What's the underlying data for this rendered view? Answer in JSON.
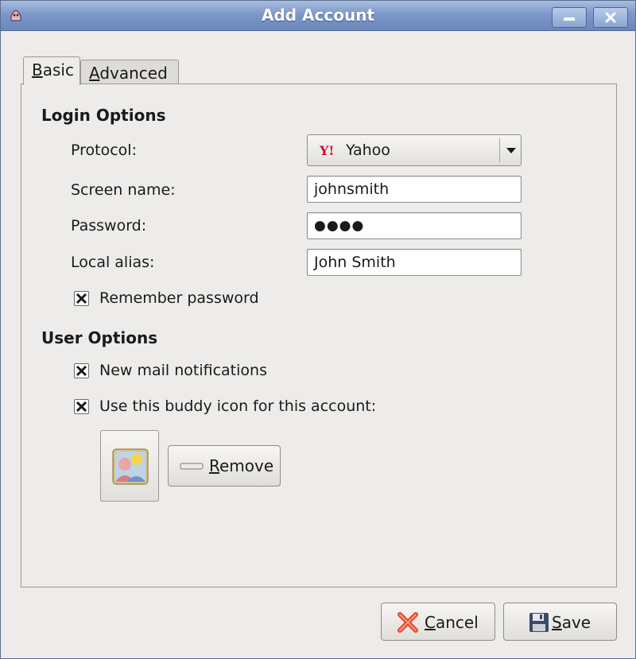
{
  "window": {
    "title": "Add Account",
    "minimize_icon": "minimize-icon",
    "close_label": "x"
  },
  "tabs": [
    {
      "label": "Basic",
      "selected": true
    },
    {
      "label": "Advanced",
      "selected": false
    }
  ],
  "login_options": {
    "title": "Login Options",
    "protocol_label": "Protocol:",
    "protocol_value": "Yahoo",
    "protocol_icon": "yahoo-icon",
    "screen_name_label": "Screen name:",
    "screen_name_value": "johnsmith",
    "password_label": "Password:",
    "password_value": "●●●●",
    "local_alias_label": "Local alias:",
    "local_alias_value": "John Smith",
    "remember_password_label": "Remember password",
    "remember_password_checked": true
  },
  "user_options": {
    "title": "User Options",
    "new_mail_label": "New mail notifications",
    "new_mail_checked": true,
    "buddy_icon_label": "Use this buddy icon for this account:",
    "buddy_icon_checked": true,
    "remove_label": "Remove"
  },
  "footer": {
    "cancel_label": "Cancel",
    "save_label": "Save"
  },
  "colors": {
    "titlebar": "#7d98c8",
    "window_bg": "#edecea",
    "yahoo_red": "#c8102e",
    "cancel_red": "#e8432d"
  }
}
